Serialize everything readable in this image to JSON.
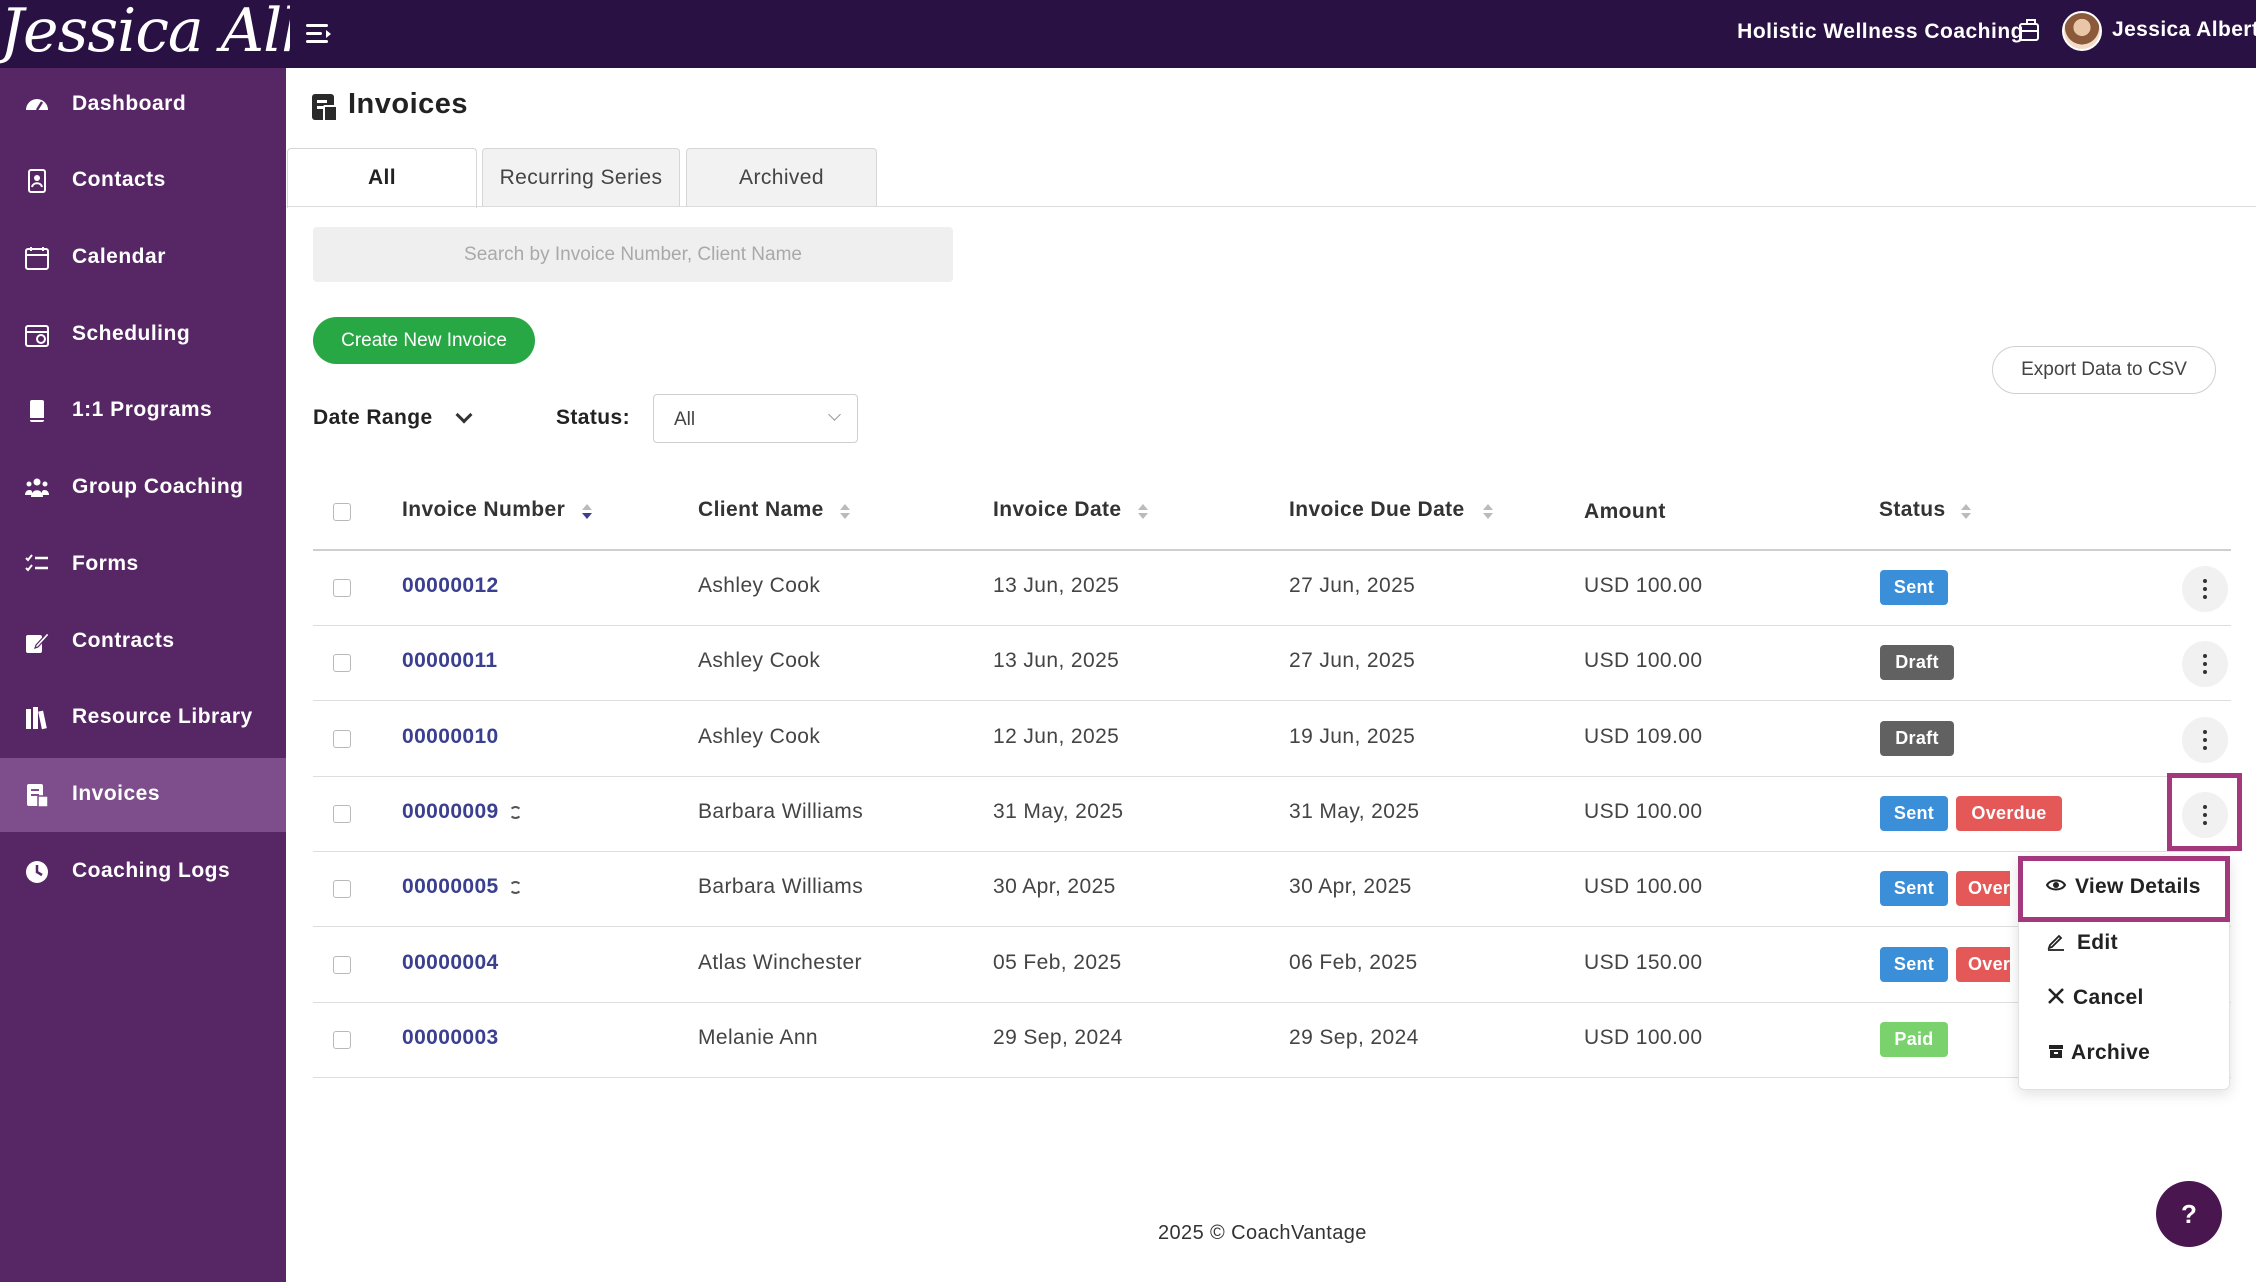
{
  "app": {
    "brand": "Jessica Albert",
    "org": "Holistic Wellness Coaching",
    "user": "Jessica Albert"
  },
  "sidebar": {
    "items": [
      {
        "label": "Dashboard",
        "icon": "dashboard-icon"
      },
      {
        "label": "Contacts",
        "icon": "contacts-icon"
      },
      {
        "label": "Calendar",
        "icon": "calendar-icon"
      },
      {
        "label": "Scheduling",
        "icon": "scheduling-icon"
      },
      {
        "label": "1:1 Programs",
        "icon": "book-icon"
      },
      {
        "label": "Group Coaching",
        "icon": "group-icon"
      },
      {
        "label": "Forms",
        "icon": "forms-icon"
      },
      {
        "label": "Contracts",
        "icon": "contract-icon"
      },
      {
        "label": "Resource Library",
        "icon": "library-icon"
      },
      {
        "label": "Invoices",
        "icon": "invoice-icon",
        "active": true
      },
      {
        "label": "Coaching Logs",
        "icon": "clock-icon"
      }
    ]
  },
  "page": {
    "title": "Invoices",
    "tabs": [
      {
        "label": "All",
        "active": true
      },
      {
        "label": "Recurring Series"
      },
      {
        "label": "Archived"
      }
    ],
    "search": {
      "placeholder": "Search by Invoice Number, Client Name",
      "value": ""
    },
    "create_label": "Create New Invoice",
    "export_label": "Export Data to CSV",
    "filters": {
      "date_range_label": "Date Range",
      "status_label": "Status:",
      "status_value": "All"
    }
  },
  "table": {
    "headers": {
      "invoice_number": "Invoice Number",
      "client_name": "Client Name",
      "invoice_date": "Invoice Date",
      "due_date": "Invoice Due Date",
      "amount": "Amount",
      "status": "Status"
    },
    "rows": [
      {
        "number": "00000012",
        "recurring": false,
        "client": "Ashley Cook",
        "date": "13 Jun, 2025",
        "due": "27 Jun, 2025",
        "amount": "USD 100.00",
        "status": [
          "Sent"
        ]
      },
      {
        "number": "00000011",
        "recurring": false,
        "client": "Ashley Cook",
        "date": "13 Jun, 2025",
        "due": "27 Jun, 2025",
        "amount": "USD 100.00",
        "status": [
          "Draft"
        ]
      },
      {
        "number": "00000010",
        "recurring": false,
        "client": "Ashley Cook",
        "date": "12 Jun, 2025",
        "due": "19 Jun, 2025",
        "amount": "USD 109.00",
        "status": [
          "Draft"
        ]
      },
      {
        "number": "00000009",
        "recurring": true,
        "client": "Barbara Williams",
        "date": "31 May, 2025",
        "due": "31 May, 2025",
        "amount": "USD 100.00",
        "status": [
          "Sent",
          "Overdue"
        ]
      },
      {
        "number": "00000005",
        "recurring": true,
        "client": "Barbara Williams",
        "date": "30 Apr, 2025",
        "due": "30 Apr, 2025",
        "amount": "USD 100.00",
        "status": [
          "Sent",
          "Overdue"
        ]
      },
      {
        "number": "00000004",
        "recurring": false,
        "client": "Atlas Winchester",
        "date": "05 Feb, 2025",
        "due": "06 Feb, 2025",
        "amount": "USD 150.00",
        "status": [
          "Sent",
          "Overdue"
        ]
      },
      {
        "number": "00000003",
        "recurring": false,
        "client": "Melanie Ann",
        "date": "29 Sep, 2024",
        "due": "29 Sep, 2024",
        "amount": "USD 100.00",
        "status": [
          "Paid"
        ]
      }
    ]
  },
  "status_colors": {
    "Sent": "#3b8fd9",
    "Draft": "#616161",
    "Overdue": "#e45858",
    "Paid": "#79d26c"
  },
  "row_menu": {
    "items": [
      {
        "label": "View Details",
        "icon": "eye-icon"
      },
      {
        "label": "Edit",
        "icon": "pencil-icon"
      },
      {
        "label": "Cancel",
        "icon": "close-icon"
      },
      {
        "label": "Archive",
        "icon": "archive-icon"
      }
    ]
  },
  "footer": {
    "text": "2025 © CoachVantage"
  },
  "help_label": "?"
}
